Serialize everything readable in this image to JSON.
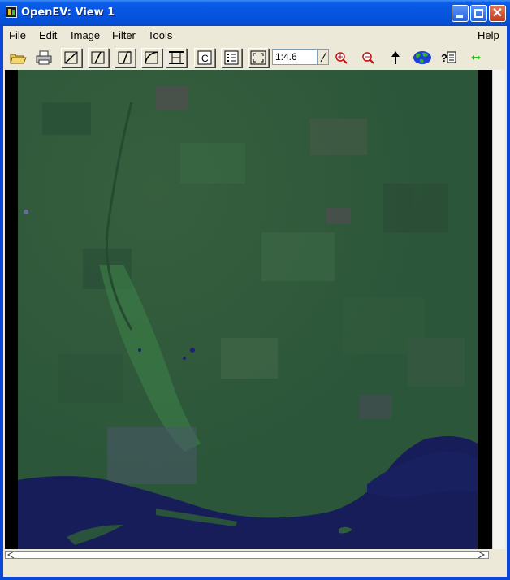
{
  "window": {
    "title": "OpenEV: View 1"
  },
  "menubar": {
    "items": [
      "File",
      "Edit",
      "Image",
      "Filter",
      "Tools"
    ],
    "help": "Help"
  },
  "toolbar": {
    "zoom_value": "1:4.6",
    "tools": [
      "open-folder-icon",
      "print-icon",
      "draw-line-icon",
      "draw-line-alt-icon",
      "draw-line-2-icon",
      "draw-curve-icon",
      "roi-box-icon",
      "contrast-c-icon",
      "legend-list-icon",
      "fit-extents-icon",
      "zoom-in-icon",
      "zoom-out-icon",
      "up-arrow-icon",
      "globe-icon",
      "help-query-icon",
      "green-arrows-icon"
    ]
  },
  "colors": {
    "land": "#2f5a3b",
    "water": "#171d59",
    "titlebar": "#0a5ce8"
  }
}
